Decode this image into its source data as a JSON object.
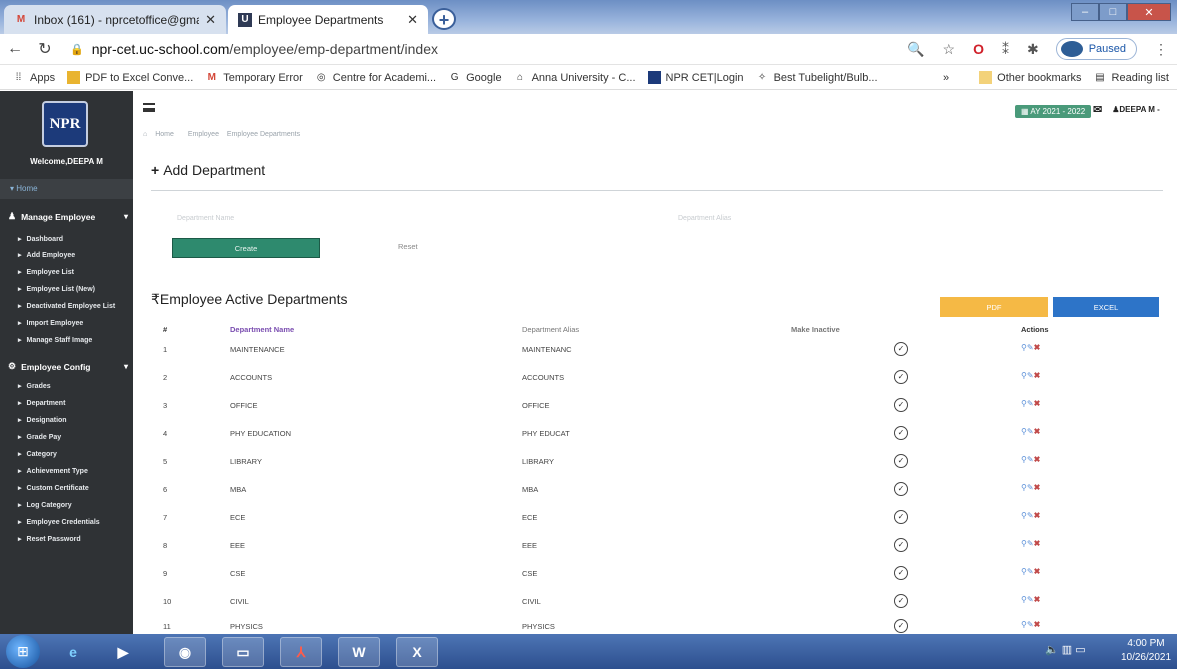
{
  "browser": {
    "tabs": [
      {
        "title": "Inbox (161) - nprcetoffice@gma",
        "active": false
      },
      {
        "title": "Employee Departments",
        "active": true
      }
    ],
    "url_prefix": "npr-cet.uc-school.com",
    "url_path": "/employee/emp-department/index",
    "profile_status": "Paused",
    "bookmarks": [
      {
        "label": "Apps",
        "icon": "apps-icon"
      },
      {
        "label": "PDF to Excel Conve...",
        "icon": "pdf-icon"
      },
      {
        "label": "Temporary Error",
        "icon": "gmail-icon"
      },
      {
        "label": "Centre for Academi...",
        "icon": "globe-icon"
      },
      {
        "label": "Google",
        "icon": "google-icon"
      },
      {
        "label": "Anna University - C...",
        "icon": "university-icon"
      },
      {
        "label": "NPR CET|Login",
        "icon": "npr-icon"
      },
      {
        "label": "Best Tubelight/Bulb...",
        "icon": "bulb-icon"
      }
    ],
    "bookmarks_more": "»",
    "other_bookmarks": "Other bookmarks",
    "reading_list": "Reading list"
  },
  "sidebar": {
    "logo_text": "NPR",
    "welcome": "Welcome,DEEPA M",
    "home": "Home",
    "sections": [
      {
        "title": "Manage Employee",
        "icon": "user-icon",
        "items": [
          "Dashboard",
          "Add Employee",
          "Employee List",
          "Employee List (New)",
          "Deactivated Employee List",
          "Import Employee",
          "Manage Staff Image"
        ]
      },
      {
        "title": "Employee Config",
        "icon": "gear-icon",
        "items": [
          "Grades",
          "Department",
          "Designation",
          "Grade Pay",
          "Category",
          "Achievement Type",
          "Custom Certificate",
          "Log Category",
          "Employee Credentials",
          "Reset Password"
        ]
      }
    ]
  },
  "header": {
    "academic_year": "AY 2021 - 2022",
    "user_name": "DEEPA M -"
  },
  "breadcrumb": [
    "Home",
    "Employee",
    "Employee Departments"
  ],
  "add_form": {
    "title": "Add Department",
    "department_name_label": "Department Name",
    "department_alias_label": "Department Alias",
    "create_label": "Create",
    "reset_label": "Reset"
  },
  "list": {
    "title": "Employee Active Departments",
    "pdf_label": "PDF",
    "excel_label": "EXCEL",
    "columns": [
      "#",
      "Department Name",
      "Department Alias",
      "Make Inactive",
      "Actions"
    ],
    "rows": [
      {
        "no": "1",
        "name": "MAINTENANCE",
        "alias": "MAINTENANC"
      },
      {
        "no": "2",
        "name": "ACCOUNTS",
        "alias": "ACCOUNTS"
      },
      {
        "no": "3",
        "name": "OFFICE",
        "alias": "OFFICE"
      },
      {
        "no": "4",
        "name": "PHY EDUCATION",
        "alias": "PHY EDUCAT"
      },
      {
        "no": "5",
        "name": "LIBRARY",
        "alias": "LIBRARY"
      },
      {
        "no": "6",
        "name": "MBA",
        "alias": "MBA"
      },
      {
        "no": "7",
        "name": "ECE",
        "alias": "ECE"
      },
      {
        "no": "8",
        "name": "EEE",
        "alias": "EEE"
      },
      {
        "no": "9",
        "name": "CSE",
        "alias": "CSE"
      },
      {
        "no": "10",
        "name": "CIVIL",
        "alias": "CIVIL"
      },
      {
        "no": "11",
        "name": "PHYSICS",
        "alias": "PHYSICS"
      }
    ]
  },
  "taskbar": {
    "time": "4:00 PM",
    "date": "10/26/2021"
  },
  "colors": {
    "sidebar_bg": "#2f3235",
    "create_button": "#2e8a6e",
    "pdf_button": "#f5b945",
    "excel_button": "#2d74c8",
    "accent_link": "#7a4db0"
  }
}
